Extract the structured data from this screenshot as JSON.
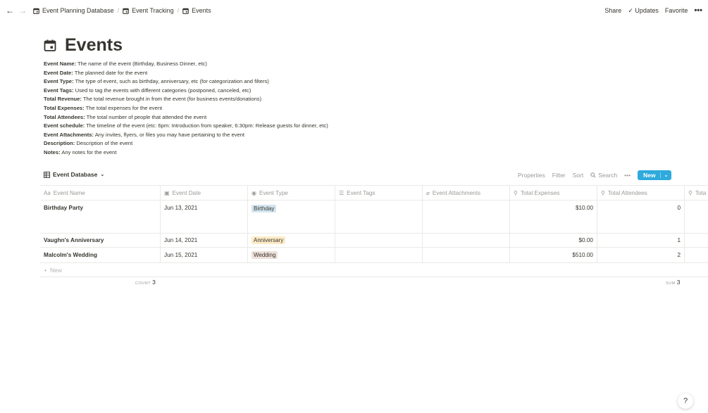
{
  "breadcrumbs": [
    "Event Planning Database",
    "Event Tracking",
    "Events"
  ],
  "topbar": {
    "share": "Share",
    "updates": "Updates",
    "favorite": "Favorite",
    "more": "•••"
  },
  "page": {
    "title": "Events"
  },
  "description": [
    {
      "label": "Event Name:",
      "text": " The name of the event (Birthday, Business Dinner, etc)"
    },
    {
      "label": "Event Date:",
      "text": " The planned date for the event"
    },
    {
      "label": "Event Type:",
      "text": " The type of event, such as birthday, anniversary, etc (for categorization and filters)"
    },
    {
      "label": "Event Tags:",
      "text": " Used to tag the events with different categories (postponed, canceled, etc)"
    },
    {
      "label": "Total Revenue:",
      "text": " The total revenue brought in from the event (for business events/donations)"
    },
    {
      "label": "Total Expenses:",
      "text": " The total expenses for the event"
    },
    {
      "label": "Total Attendees:",
      "text": " The total number of people that attended the event"
    },
    {
      "label": "Event schedule:",
      "text": " The timeline of the event (etc: 6pm: Introduction from speaker, 6:30pm: Release guests for dinner, etc)"
    },
    {
      "label": "Event Attachments:",
      "text": " Any invites, flyers, or files you may have pertaining to the event"
    },
    {
      "label": "Description:",
      "text": " Description of the event"
    },
    {
      "label": "Notes:",
      "text": " Any notes for the event"
    }
  ],
  "database": {
    "view_name": "Event Database",
    "tools": {
      "properties": "Properties",
      "filter": "Filter",
      "sort": "Sort",
      "search": "Search",
      "more": "•••",
      "new": "New"
    },
    "columns": [
      "Event Name",
      "Event Date",
      "Event Type",
      "Event Tags",
      "Event Attachments",
      "Total Expenses",
      "Total Attendees",
      "Tota"
    ],
    "rows": [
      {
        "name": "Birthday Party",
        "date": "Jun 13, 2021",
        "type": "Birthday",
        "type_color": "#d3e5ef",
        "expenses": "$10.00",
        "attendees": "0"
      },
      {
        "name": "Vaughn's Anniversary",
        "date": "Jun 14, 2021",
        "type": "Anniversary",
        "type_color": "#fdecc8",
        "expenses": "$0.00",
        "attendees": "1"
      },
      {
        "name": "Malcolm's Wedding",
        "date": "Jun 15, 2021",
        "type": "Wedding",
        "type_color": "#eee0da",
        "expenses": "$510.00",
        "attendees": "2"
      }
    ],
    "new_row": "New",
    "footer": {
      "count_label": "COUNT",
      "count_value": "3",
      "sum_label": "SUM",
      "sum_value": "3"
    }
  },
  "help": "?"
}
